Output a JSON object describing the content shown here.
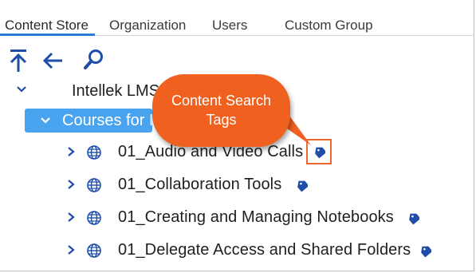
{
  "tabs": [
    {
      "label": "Content Store",
      "active": true
    },
    {
      "label": "Organization"
    },
    {
      "label": "Users"
    },
    {
      "label": "Custom Group"
    }
  ],
  "toolbar": {
    "icons": [
      "move-to-top-icon",
      "back-arrow-icon",
      "search-icon"
    ]
  },
  "tree": {
    "root_label": "Intellek LMS",
    "selected_label": "Courses for I",
    "items": [
      {
        "label": "01_Audio and Video Calls"
      },
      {
        "label": "01_Collaboration Tools"
      },
      {
        "label": "01_Creating and Managing Notebooks"
      },
      {
        "label": "01_Delegate Access and Shared Folders"
      }
    ]
  },
  "callout": {
    "line1": "Content Search",
    "line2": "Tags"
  },
  "colors": {
    "accent": "#2a7bd6",
    "selected_row": "#4aa3ef",
    "callout": "#f0601e",
    "tag_icon": "#1e4ea8",
    "highlight_border": "#ea6a2e"
  }
}
